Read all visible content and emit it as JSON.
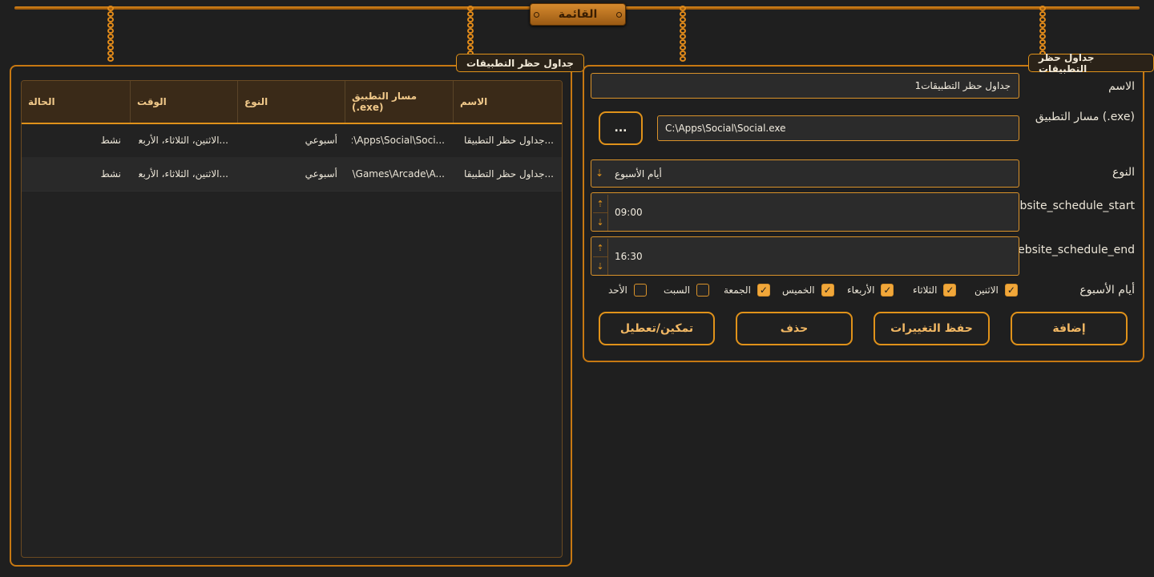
{
  "menu": {
    "title": "القائمة"
  },
  "left_panel": {
    "title": "جداول حظر التطبيقات",
    "columns": [
      "الاسم",
      "مسار التطبيق (.exe)",
      "النوع",
      "الوقت",
      "الحالة"
    ],
    "rows": [
      [
        "جداول حظر التطبيقا...",
        "C:\\Apps\\Social\\Soci...",
        "أسبوعي",
        "الاثنين، الثلاثاء، الأربعا...",
        "نشط"
      ],
      [
        "جداول حظر التطبيقا...",
        "C:\\Games\\Arcade\\A...",
        "أسبوعي",
        "الاثنين، الثلاثاء، الأربعا...",
        "نشط"
      ]
    ]
  },
  "form": {
    "title": "جداول حظر التطبيقات",
    "name_label": "الاسم",
    "name_value": "جداول حظر التطبيقات1",
    "path_label": "مسار التطبيق (.exe)",
    "path_value": "C:\\Apps\\Social\\Social.exe",
    "browse_label": "...",
    "type_label": "النوع",
    "type_value": "أيام الأسبوع",
    "start_label": "website_schedule_start",
    "start_value": "09:00",
    "end_label": "website_schedule_end",
    "end_value": "16:30",
    "days_label": "أيام الأسبوع",
    "days": [
      {
        "label": "الاثنين",
        "checked": true
      },
      {
        "label": "الثلاثاء",
        "checked": true
      },
      {
        "label": "الأربعاء",
        "checked": true
      },
      {
        "label": "الخميس",
        "checked": true
      },
      {
        "label": "الجمعة",
        "checked": true
      },
      {
        "label": "السبت",
        "checked": false
      },
      {
        "label": "الأحد",
        "checked": false
      }
    ],
    "buttons": {
      "add": "إضافة",
      "save": "حفظ التغييرات",
      "delete": "حذف",
      "toggle": "تمكين/تعطيل"
    }
  },
  "icons": {
    "combo_arrow": "arrow-down-icon",
    "spin_up": "arrow-up-icon",
    "spin_down": "arrow-down-icon",
    "check": "check-icon"
  },
  "colors": {
    "accent": "#e0921a",
    "background": "#1f1f1f",
    "header_text": "#f1c98a"
  }
}
